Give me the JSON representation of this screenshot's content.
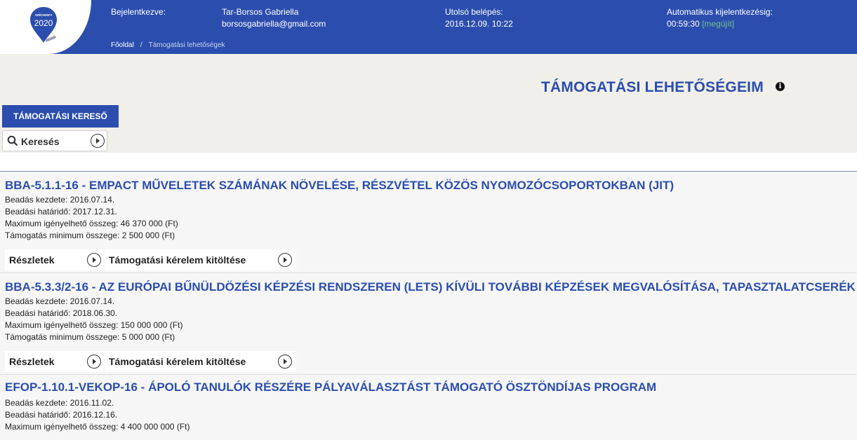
{
  "header": {
    "logo_top": "SZÉCHENYI",
    "logo_year": "2020",
    "logged_in_label": "Bejelentkezve:",
    "user_name": "Tar-Borsos Gabriella",
    "user_email": "borsosgabriella@gmail.com",
    "last_login_label": "Utolsó belépés:",
    "last_login_value": "2016.12.09. 10:22",
    "auto_logout_label": "Automatikus kijelentkezésig:",
    "auto_logout_value": "00:59:30",
    "renew_label": "[megújít]",
    "colors": {
      "primary": "#2b4eae",
      "renew": "#6fbf8b"
    }
  },
  "breadcrumb": {
    "home": "Főoldal",
    "separator": "/",
    "current": "Támogatási lehetőségek"
  },
  "page": {
    "title": "TÁMOGATÁSI LEHETŐSÉGEIM",
    "info_icon": "info-icon",
    "search_tab": "TÁMOGATÁSI KERESŐ",
    "search_button": "Keresés"
  },
  "items": [
    {
      "title": "BBA-5.1.1-16 - EMPACT MŰVELETEK SZÁMÁNAK NÖVELÉSE, RÉSZVÉTEL KÖZÖS NYOMOZÓCSOPORTOKBAN (JIT)",
      "start": "Beadás kezdete: 2016.07.14.",
      "deadline": "Beadási határidő: 2017.12.31.",
      "max": "Maximum igényelhető összeg: 46 370 000 (Ft)",
      "min": "Támogatás minimum összege: 2 500 000 (Ft)",
      "details": "Részletek",
      "apply": "Támogatási kérelem kitöltése"
    },
    {
      "title": "BBA-5.3.3/2-16 - AZ EURÓPAI BŰNÜLDÖZÉSI KÉPZÉSI RENDSZEREN (LETS) KÍVÜLI TOVÁBBI KÉPZÉSEK MEGVALÓSÍTÁSA, TAPASZTALATCSERÉK",
      "start": "Beadás kezdete: 2016.07.14.",
      "deadline": "Beadási határidő: 2018.06.30.",
      "max": "Maximum igényelhető összeg: 150 000 000 (Ft)",
      "min": "Támogatás minimum összege: 5 000 000 (Ft)",
      "details": "Részletek",
      "apply": "Támogatási kérelem kitöltése"
    },
    {
      "title": "EFOP-1.10.1-VEKOP-16 - ÁPOLÓ TANULÓK RÉSZÉRE PÁLYAVÁLASZTÁST TÁMOGATÓ ÖSZTÖNDÍJAS PROGRAM",
      "start": "Beadás kezdete: 2016.11.02.",
      "deadline": "Beadási határidő: 2016.12.16.",
      "max": "Maximum igényelhető összeg: 4 400 000 000 (Ft)"
    }
  ]
}
